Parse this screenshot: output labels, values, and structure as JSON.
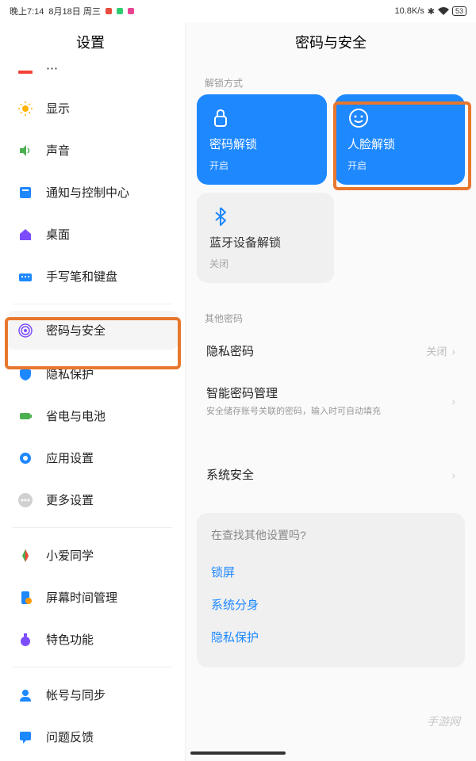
{
  "statusbar": {
    "time": "晚上7:14",
    "date": "8月18日 周三",
    "speed": "10.8K/s",
    "battery": "53"
  },
  "sidebar": {
    "title": "设置",
    "items": [
      {
        "label": "显示",
        "icon": "sun",
        "color": "#ffb300"
      },
      {
        "label": "声音",
        "icon": "speaker",
        "color": "#4caf50"
      },
      {
        "label": "通知与控制中心",
        "icon": "notif",
        "color": "#1e88ff"
      },
      {
        "label": "桌面",
        "icon": "home",
        "color": "#7c4dff"
      },
      {
        "label": "手写笔和键盘",
        "icon": "keyboard",
        "color": "#1e88ff"
      },
      {
        "label": "密码与安全",
        "icon": "fingerprint",
        "color": "#7c4dff",
        "selected": true
      },
      {
        "label": "隐私保护",
        "icon": "shield",
        "color": "#1e88ff"
      },
      {
        "label": "省电与电池",
        "icon": "battery",
        "color": "#4caf50"
      },
      {
        "label": "应用设置",
        "icon": "gear",
        "color": "#1e88ff"
      },
      {
        "label": "更多设置",
        "icon": "dots",
        "color": "#bdbdbd"
      },
      {
        "label": "小爱同学",
        "icon": "ai",
        "color": "#multicolor"
      },
      {
        "label": "屏幕时间管理",
        "icon": "screentime",
        "color": "#1e88ff"
      },
      {
        "label": "特色功能",
        "icon": "special",
        "color": "#7c4dff"
      },
      {
        "label": "帐号与同步",
        "icon": "account",
        "color": "#1e88ff"
      },
      {
        "label": "问题反馈",
        "icon": "feedback",
        "color": "#1e88ff"
      }
    ]
  },
  "content": {
    "title": "密码与安全",
    "unlock_section": "解锁方式",
    "cards": [
      {
        "title": "密码解锁",
        "status": "开启",
        "variant": "blue",
        "icon": "lock"
      },
      {
        "title": "人脸解锁",
        "status": "开启",
        "variant": "blue",
        "icon": "face",
        "highlighted": true
      },
      {
        "title": "蓝牙设备解锁",
        "status": "关闭",
        "variant": "gray",
        "icon": "bluetooth"
      }
    ],
    "other_section": "其他密码",
    "privacy_password": {
      "title": "隐私密码",
      "status": "关闭"
    },
    "smart_password": {
      "title": "智能密码管理",
      "sub": "安全储存账号关联的密码，输入时可自动填充"
    },
    "system_security": {
      "title": "系统安全"
    },
    "suggest": {
      "title": "在查找其他设置吗?",
      "links": [
        "锁屏",
        "系统分身",
        "隐私保护"
      ]
    }
  },
  "watermark": "手游网"
}
